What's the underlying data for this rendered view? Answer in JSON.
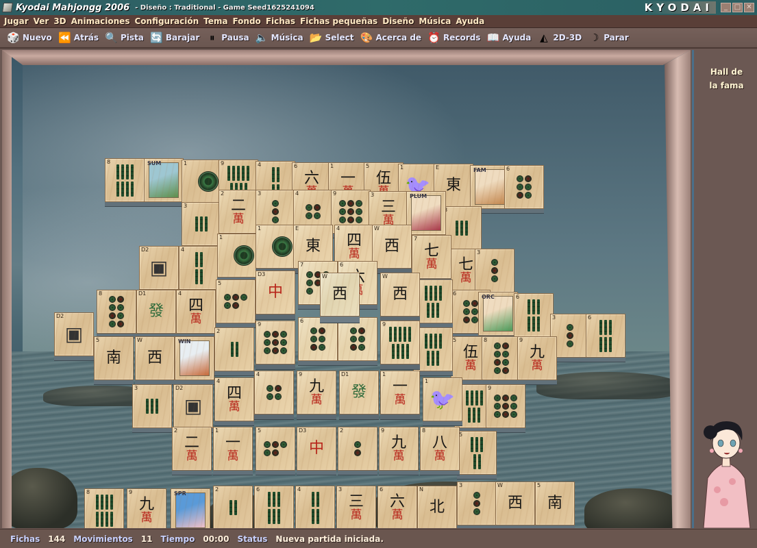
{
  "window": {
    "title": "Kyodai Mahjongg 2006",
    "subtitle": "- Diseño : Traditional - Game Seed1625241094",
    "brand": "KYODAI",
    "controls": {
      "minimize": "_",
      "maximize": "□",
      "close": "✕"
    }
  },
  "menu": [
    "Jugar",
    "Ver",
    "3D",
    "Animaciones",
    "Configuración",
    "Tema",
    "Fondo",
    "Fichas",
    "Fichas pequeñas",
    "Diseño",
    "Música",
    "Ayuda"
  ],
  "toolbar": [
    {
      "label": "Nuevo",
      "icon": "dice-icon",
      "glyph": "🎲"
    },
    {
      "label": "Atrás",
      "icon": "rewind-icon",
      "glyph": "⏪"
    },
    {
      "label": "Pista",
      "icon": "magnifier-icon",
      "glyph": "🔍"
    },
    {
      "label": "Barajar",
      "icon": "shuffle-icon",
      "glyph": "🔄"
    },
    {
      "label": "Pausa",
      "icon": "pause-icon",
      "glyph": "⏸"
    },
    {
      "label": "Música",
      "icon": "speaker-icon",
      "glyph": "🔈"
    },
    {
      "label": "Select",
      "icon": "folder-icon",
      "glyph": "📂"
    },
    {
      "label": "Acerca de",
      "icon": "palette-icon",
      "glyph": "🎨"
    },
    {
      "label": "Records",
      "icon": "alarm-clock-icon",
      "glyph": "⏰"
    },
    {
      "label": "Ayuda",
      "icon": "help-book-icon",
      "glyph": "📖"
    },
    {
      "label": "2D-3D",
      "icon": "shapes-icon",
      "glyph": "◭"
    },
    {
      "label": "Parar",
      "icon": "moon-icon",
      "glyph": "☽"
    }
  ],
  "sidebar": {
    "hall_line1": "Hall de",
    "hall_line2": "la fama"
  },
  "status": {
    "fichas_label": "Fichas",
    "fichas_value": "144",
    "movimientos_label": "Movimientos",
    "movimientos_value": "11",
    "tiempo_label": "Tiempo",
    "tiempo_value": "00:00",
    "status_label": "Status",
    "status_value": "Nueva partida iniciada."
  },
  "tiles": [
    {
      "id": "8",
      "kind": "bam",
      "n": 8
    },
    {
      "id": "",
      "kind": "flower",
      "n": 0,
      "name": "SUM"
    },
    {
      "id": "1",
      "kind": "dot",
      "n": 1
    },
    {
      "id": "9",
      "kind": "bam",
      "n": 9
    },
    {
      "id": "4",
      "kind": "bam",
      "n": 4
    },
    {
      "id": "6",
      "kind": "char",
      "g": "六"
    },
    {
      "id": "1",
      "kind": "char",
      "g": "一"
    },
    {
      "id": "5",
      "kind": "char",
      "g": "伍"
    },
    {
      "id": "1",
      "kind": "bird"
    },
    {
      "id": "E",
      "kind": "wind",
      "g": "東"
    },
    {
      "id": "",
      "kind": "flower",
      "name": "FAM"
    },
    {
      "id": "6",
      "kind": "dot",
      "n": 6
    },
    {
      "id": "3",
      "kind": "bam",
      "n": 3
    },
    {
      "id": "2",
      "kind": "char",
      "g": "二"
    },
    {
      "id": "3",
      "kind": "dot",
      "n": 3
    },
    {
      "id": "4",
      "kind": "dot",
      "n": 4
    },
    {
      "id": "9",
      "kind": "dot",
      "n": 9
    },
    {
      "id": "3",
      "kind": "char",
      "g": "三"
    },
    {
      "id": "",
      "kind": "flower",
      "name": "PLUM"
    },
    {
      "id": "3",
      "kind": "bam",
      "n": 3
    },
    {
      "id": "1",
      "kind": "dot",
      "n": 1
    },
    {
      "id": "E",
      "kind": "wind",
      "g": "東"
    },
    {
      "id": "4",
      "kind": "char",
      "g": "四"
    },
    {
      "id": "W",
      "kind": "wind",
      "g": "西"
    },
    {
      "id": "7",
      "kind": "char",
      "g": "七"
    },
    {
      "id": "7",
      "kind": "char",
      "g": "七"
    },
    {
      "id": "D2",
      "kind": "dragon",
      "g": "▣"
    },
    {
      "id": "4",
      "kind": "bam",
      "n": 4
    },
    {
      "id": "1",
      "kind": "dot",
      "n": 1
    },
    {
      "id": "3",
      "kind": "dot",
      "n": 3
    },
    {
      "id": "D3",
      "kind": "dragon",
      "g": "中"
    },
    {
      "id": "7",
      "kind": "dot",
      "n": 7
    },
    {
      "id": "6",
      "kind": "char",
      "g": "六"
    },
    {
      "id": "W",
      "kind": "wind",
      "g": "西"
    },
    {
      "id": "8",
      "kind": "dot",
      "n": 8
    },
    {
      "id": "D1",
      "kind": "dragon",
      "g": "發"
    },
    {
      "id": "4",
      "kind": "char",
      "g": "四"
    },
    {
      "id": "5",
      "kind": "dot",
      "n": 5
    },
    {
      "id": "7",
      "kind": "bam",
      "n": 7
    },
    {
      "id": "6",
      "kind": "dot",
      "n": 6
    },
    {
      "id": "",
      "kind": "flower",
      "name": "ORC"
    },
    {
      "id": "6",
      "kind": "bam",
      "n": 6
    },
    {
      "id": "D2",
      "kind": "dragon",
      "g": "▣"
    },
    {
      "id": "3",
      "kind": "dot",
      "n": 3
    },
    {
      "id": "6",
      "kind": "bam",
      "n": 6
    },
    {
      "id": "5",
      "kind": "wind",
      "g": "南"
    },
    {
      "id": "W",
      "kind": "wind",
      "g": "西"
    },
    {
      "id": "",
      "kind": "flower",
      "name": "WIN"
    },
    {
      "id": "2",
      "kind": "bam",
      "n": 2
    },
    {
      "id": "9",
      "kind": "dot",
      "n": 9
    },
    {
      "id": "6",
      "kind": "dot",
      "n": 6
    },
    {
      "id": "6",
      "kind": "dot",
      "n": 6
    },
    {
      "id": "9",
      "kind": "bam",
      "n": 9
    },
    {
      "id": "7",
      "kind": "bam",
      "n": 7
    },
    {
      "id": "5",
      "kind": "char",
      "g": "伍"
    },
    {
      "id": "8",
      "kind": "dot",
      "n": 8
    },
    {
      "id": "9",
      "kind": "char",
      "g": "九"
    },
    {
      "id": "3",
      "kind": "bam",
      "n": 3
    },
    {
      "id": "D2",
      "kind": "dragon",
      "g": "▣"
    },
    {
      "id": "4",
      "kind": "char",
      "g": "四"
    },
    {
      "id": "4",
      "kind": "dot",
      "n": 4
    },
    {
      "id": "9",
      "kind": "char",
      "g": "九"
    },
    {
      "id": "D1",
      "kind": "dragon",
      "g": "發"
    },
    {
      "id": "1",
      "kind": "char",
      "g": "一"
    },
    {
      "id": "1",
      "kind": "bird"
    },
    {
      "id": "7",
      "kind": "bam",
      "n": 7
    },
    {
      "id": "9",
      "kind": "dot",
      "n": 9
    },
    {
      "id": "2",
      "kind": "char",
      "g": "二"
    },
    {
      "id": "1",
      "kind": "char",
      "g": "一"
    },
    {
      "id": "5",
      "kind": "dot",
      "n": 5
    },
    {
      "id": "D3",
      "kind": "dragon",
      "g": "中"
    },
    {
      "id": "2",
      "kind": "dot",
      "n": 2
    },
    {
      "id": "9",
      "kind": "char",
      "g": "九"
    },
    {
      "id": "8",
      "kind": "char",
      "g": "八"
    },
    {
      "id": "5",
      "kind": "bam",
      "n": 5
    },
    {
      "id": "8",
      "kind": "bam",
      "n": 8
    },
    {
      "id": "9",
      "kind": "char",
      "g": "九"
    },
    {
      "id": "",
      "kind": "flower",
      "name": "SPR"
    },
    {
      "id": "2",
      "kind": "bam",
      "n": 2
    },
    {
      "id": "6",
      "kind": "bam",
      "n": 6
    },
    {
      "id": "4",
      "kind": "bam",
      "n": 4
    },
    {
      "id": "3",
      "kind": "char",
      "g": "三"
    },
    {
      "id": "6",
      "kind": "char",
      "g": "六"
    },
    {
      "id": "N",
      "kind": "wind",
      "g": "北"
    },
    {
      "id": "3",
      "kind": "dot",
      "n": 3
    },
    {
      "id": "W",
      "kind": "wind",
      "g": "西"
    },
    {
      "id": "5",
      "kind": "wind",
      "g": "南"
    },
    {
      "id": "W",
      "kind": "wind",
      "g": "西"
    }
  ]
}
